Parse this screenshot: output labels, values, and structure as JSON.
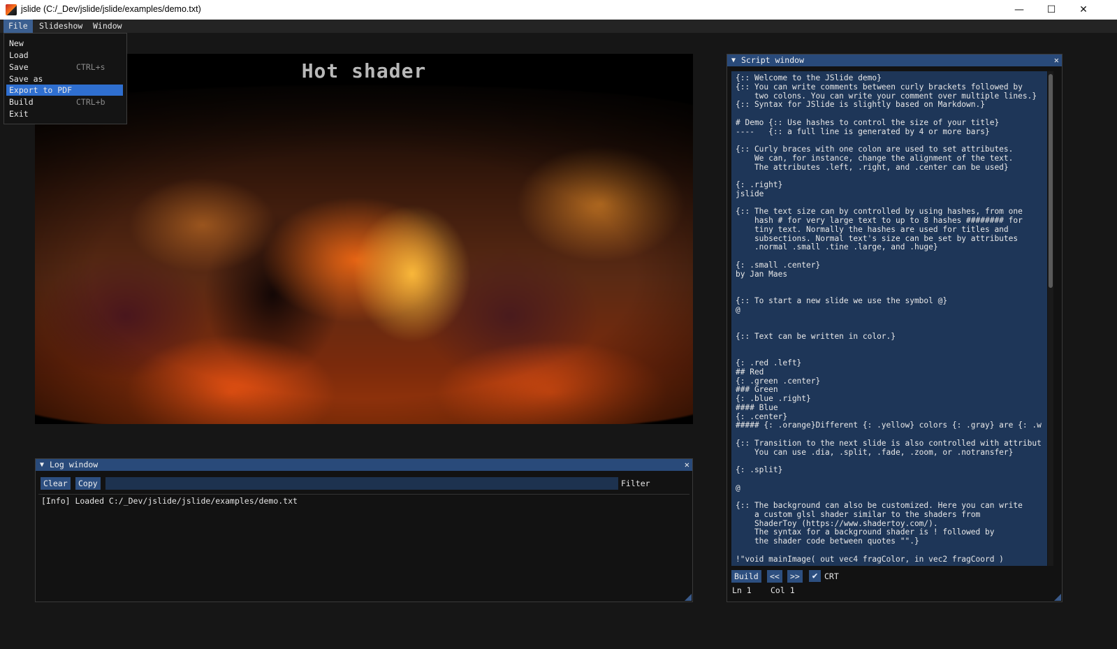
{
  "window": {
    "title": "jslide (C:/_Dev/jslide/jslide/examples/demo.txt)",
    "controls": {
      "minimize": "—",
      "maximize": "☐",
      "close": "✕"
    }
  },
  "menubar": {
    "file": "File",
    "slideshow": "Slideshow",
    "window": "Window"
  },
  "file_menu": {
    "new": "New",
    "load": "Load",
    "save": "Save",
    "save_shortcut": "CTRL+s",
    "save_as": "Save as",
    "export_pdf": "Export to PDF",
    "build": "Build",
    "build_shortcut": "CTRL+b",
    "exit": "Exit"
  },
  "slide": {
    "title": "Hot shader"
  },
  "log_window": {
    "title": "Log window",
    "clear": "Clear",
    "copy": "Copy",
    "filter_value": "",
    "filter_label": "Filter",
    "entries": [
      "[Info] Loaded C:/_Dev/jslide/jslide/examples/demo.txt"
    ]
  },
  "script_window": {
    "title": "Script window",
    "content": "{:: Welcome to the JSlide demo}\n{:: You can write comments between curly brackets followed by\n    two colons. You can write your comment over multiple lines.}\n{:: Syntax for JSlide is slightly based on Markdown.}\n\n# Demo {:: Use hashes to control the size of your title}\n----   {:: a full line is generated by 4 or more bars}\n\n{:: Curly braces with one colon are used to set attributes.\n    We can, for instance, change the alignment of the text.\n    The attributes .left, .right, and .center can be used}\n\n{: .right}\njslide\n\n{:: The text size can by controlled by using hashes, from one\n    hash # for very large text to up to 8 hashes ######## for\n    tiny text. Normally the hashes are used for titles and\n    subsections. Normal text's size can be set by attributes\n    .normal .small .tine .large, and .huge}\n\n{: .small .center}\nby Jan Maes\n\n\n{:: To start a new slide we use the symbol @}\n@\n\n\n{:: Text can be written in color.}\n\n\n{: .red .left}\n## Red\n{: .green .center}\n### Green\n{: .blue .right}\n#### Blue\n{: .center}\n##### {: .orange}Different {: .yellow} colors {: .gray} are {: .w\n\n{:: Transition to the next slide is also controlled with attribut\n    You can use .dia, .split, .fade, .zoom, or .notransfer}\n\n{: .split}\n\n@\n\n{:: The background can also be customized. Here you can write\n    a custom glsl shader similar to the shaders from\n    ShaderToy (https://www.shadertoy.com/).\n    The syntax for a background shader is ! followed by\n    the shader code between quotes \"\".}\n\n!\"void mainImage( out vec4 fragColor, in vec2 fragCoord )",
    "build": "Build",
    "prev": "<<",
    "next": ">>",
    "crt_label": "CRT",
    "crt_checked": true,
    "ln": "Ln 1",
    "col": "Col 1"
  },
  "colors": {
    "accent": "#2d4f80",
    "header": "#294a7a",
    "highlight": "#2f6fd0",
    "background": "#161616"
  }
}
